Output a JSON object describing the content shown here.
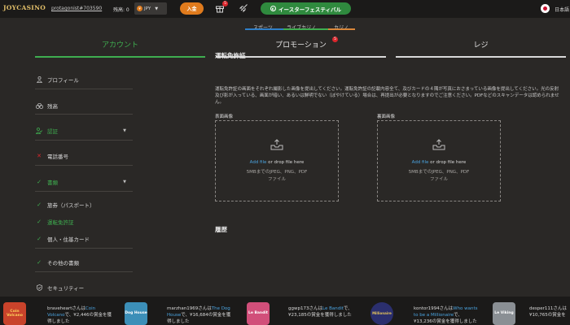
{
  "header": {
    "logo": "JOYCASINO",
    "username": "protagonist#703590",
    "balance_label": "残高: 0",
    "currency_symbol": "¥",
    "currency": "JPY",
    "deposit_label": "入金",
    "gift_count": "5",
    "promo_label": "イースターフェスティバル",
    "language": "日本語"
  },
  "subnav": {
    "items": [
      "スポーツ",
      "ライブカジノ",
      "カジノ"
    ]
  },
  "tabs": {
    "items": [
      "アカウント",
      "プロモーション",
      "レジ"
    ],
    "promo_badge": "5"
  },
  "sidebar": {
    "profile": "プロフィール",
    "balance": "残高",
    "verification": "認証",
    "phone": "電話番号",
    "documents": "書類",
    "passport": "旅券（パスポート）",
    "license": "運転免許証",
    "card": "個人・住基カード",
    "other": "その他の書類",
    "security": "セキュリティー"
  },
  "main": {
    "title": "運転免許証",
    "description": "運転免許証の画面をそれぞれ撮影した画像を提出してください。運転免許証の記載内容全て、及びカードの４隅が写真におさまっている画像を提出してください。光の反射及び影が入っている、画面が暗い、あるいは鮮明でない（ぼやけている）場合は、再提出が必要となりますのでご注意ください。PDFなどのスキャンデータは認められません。",
    "front_label": "表面画像",
    "back_label": "裏面画像",
    "add_file": "Add file",
    "drop_text": " or drop file here",
    "limit_1": "5MBまでのJPEG、PNG、PDF",
    "limit_2": "ファイル",
    "history": "履歴"
  },
  "winners": [
    {
      "thumb": "Coin Volcano",
      "prefix": "braveheartさんは",
      "game": "Coin Volcano",
      "suffix": "で、¥2,446の賞金を獲得しました",
      "color": "#c9432b"
    },
    {
      "thumb": "Dog House",
      "prefix": "marzhan1969さんは",
      "game": "The Dog House",
      "suffix": "で、¥16,684の賞金を獲得しました",
      "color": "#3c8fb8"
    },
    {
      "thumb": "Le Bandit",
      "prefix": "ggwp173さんは",
      "game": "Le Bandit",
      "suffix": "で、¥23,185の賞金を獲得しました",
      "color": "#d14f7a"
    },
    {
      "thumb": "Millionaire",
      "prefix": "kontor1994さんは",
      "game": "Who wants to be a Millionaire",
      "suffix": "で、¥13,236の賞金を獲得しました",
      "color": "#2b2f6e"
    },
    {
      "thumb": "Le Viking",
      "prefix": "desper111さんは",
      "game": "",
      "suffix": "¥10,765の賞金を",
      "color": "#8a8f94"
    }
  ]
}
